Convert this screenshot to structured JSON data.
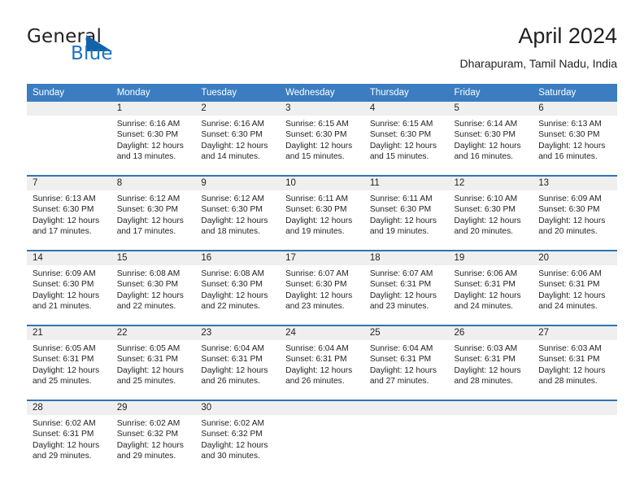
{
  "brand": {
    "word_one": "General",
    "word_two": "Blue",
    "logo_icon": "triangle-logo-icon"
  },
  "header": {
    "title": "April 2024",
    "subtitle": "Dharapuram, Tamil Nadu, India"
  },
  "colors": {
    "header_blue": "#3b7dc0",
    "row_divider_blue": "#2f73b5",
    "daynum_gray": "#efefef",
    "brand_blue": "#1e73be",
    "text": "#231f20"
  },
  "weekday_headers": [
    "Sunday",
    "Monday",
    "Tuesday",
    "Wednesday",
    "Thursday",
    "Friday",
    "Saturday"
  ],
  "weeks": [
    [
      {
        "day": "",
        "lines": []
      },
      {
        "day": "1",
        "lines": [
          "Sunrise: 6:16 AM",
          "Sunset: 6:30 PM",
          "Daylight: 12 hours",
          "and 13 minutes."
        ]
      },
      {
        "day": "2",
        "lines": [
          "Sunrise: 6:16 AM",
          "Sunset: 6:30 PM",
          "Daylight: 12 hours",
          "and 14 minutes."
        ]
      },
      {
        "day": "3",
        "lines": [
          "Sunrise: 6:15 AM",
          "Sunset: 6:30 PM",
          "Daylight: 12 hours",
          "and 15 minutes."
        ]
      },
      {
        "day": "4",
        "lines": [
          "Sunrise: 6:15 AM",
          "Sunset: 6:30 PM",
          "Daylight: 12 hours",
          "and 15 minutes."
        ]
      },
      {
        "day": "5",
        "lines": [
          "Sunrise: 6:14 AM",
          "Sunset: 6:30 PM",
          "Daylight: 12 hours",
          "and 16 minutes."
        ]
      },
      {
        "day": "6",
        "lines": [
          "Sunrise: 6:13 AM",
          "Sunset: 6:30 PM",
          "Daylight: 12 hours",
          "and 16 minutes."
        ]
      }
    ],
    [
      {
        "day": "7",
        "lines": [
          "Sunrise: 6:13 AM",
          "Sunset: 6:30 PM",
          "Daylight: 12 hours",
          "and 17 minutes."
        ]
      },
      {
        "day": "8",
        "lines": [
          "Sunrise: 6:12 AM",
          "Sunset: 6:30 PM",
          "Daylight: 12 hours",
          "and 17 minutes."
        ]
      },
      {
        "day": "9",
        "lines": [
          "Sunrise: 6:12 AM",
          "Sunset: 6:30 PM",
          "Daylight: 12 hours",
          "and 18 minutes."
        ]
      },
      {
        "day": "10",
        "lines": [
          "Sunrise: 6:11 AM",
          "Sunset: 6:30 PM",
          "Daylight: 12 hours",
          "and 19 minutes."
        ]
      },
      {
        "day": "11",
        "lines": [
          "Sunrise: 6:11 AM",
          "Sunset: 6:30 PM",
          "Daylight: 12 hours",
          "and 19 minutes."
        ]
      },
      {
        "day": "12",
        "lines": [
          "Sunrise: 6:10 AM",
          "Sunset: 6:30 PM",
          "Daylight: 12 hours",
          "and 20 minutes."
        ]
      },
      {
        "day": "13",
        "lines": [
          "Sunrise: 6:09 AM",
          "Sunset: 6:30 PM",
          "Daylight: 12 hours",
          "and 20 minutes."
        ]
      }
    ],
    [
      {
        "day": "14",
        "lines": [
          "Sunrise: 6:09 AM",
          "Sunset: 6:30 PM",
          "Daylight: 12 hours",
          "and 21 minutes."
        ]
      },
      {
        "day": "15",
        "lines": [
          "Sunrise: 6:08 AM",
          "Sunset: 6:30 PM",
          "Daylight: 12 hours",
          "and 22 minutes."
        ]
      },
      {
        "day": "16",
        "lines": [
          "Sunrise: 6:08 AM",
          "Sunset: 6:30 PM",
          "Daylight: 12 hours",
          "and 22 minutes."
        ]
      },
      {
        "day": "17",
        "lines": [
          "Sunrise: 6:07 AM",
          "Sunset: 6:30 PM",
          "Daylight: 12 hours",
          "and 23 minutes."
        ]
      },
      {
        "day": "18",
        "lines": [
          "Sunrise: 6:07 AM",
          "Sunset: 6:31 PM",
          "Daylight: 12 hours",
          "and 23 minutes."
        ]
      },
      {
        "day": "19",
        "lines": [
          "Sunrise: 6:06 AM",
          "Sunset: 6:31 PM",
          "Daylight: 12 hours",
          "and 24 minutes."
        ]
      },
      {
        "day": "20",
        "lines": [
          "Sunrise: 6:06 AM",
          "Sunset: 6:31 PM",
          "Daylight: 12 hours",
          "and 24 minutes."
        ]
      }
    ],
    [
      {
        "day": "21",
        "lines": [
          "Sunrise: 6:05 AM",
          "Sunset: 6:31 PM",
          "Daylight: 12 hours",
          "and 25 minutes."
        ]
      },
      {
        "day": "22",
        "lines": [
          "Sunrise: 6:05 AM",
          "Sunset: 6:31 PM",
          "Daylight: 12 hours",
          "and 25 minutes."
        ]
      },
      {
        "day": "23",
        "lines": [
          "Sunrise: 6:04 AM",
          "Sunset: 6:31 PM",
          "Daylight: 12 hours",
          "and 26 minutes."
        ]
      },
      {
        "day": "24",
        "lines": [
          "Sunrise: 6:04 AM",
          "Sunset: 6:31 PM",
          "Daylight: 12 hours",
          "and 26 minutes."
        ]
      },
      {
        "day": "25",
        "lines": [
          "Sunrise: 6:04 AM",
          "Sunset: 6:31 PM",
          "Daylight: 12 hours",
          "and 27 minutes."
        ]
      },
      {
        "day": "26",
        "lines": [
          "Sunrise: 6:03 AM",
          "Sunset: 6:31 PM",
          "Daylight: 12 hours",
          "and 28 minutes."
        ]
      },
      {
        "day": "27",
        "lines": [
          "Sunrise: 6:03 AM",
          "Sunset: 6:31 PM",
          "Daylight: 12 hours",
          "and 28 minutes."
        ]
      }
    ],
    [
      {
        "day": "28",
        "lines": [
          "Sunrise: 6:02 AM",
          "Sunset: 6:31 PM",
          "Daylight: 12 hours",
          "and 29 minutes."
        ]
      },
      {
        "day": "29",
        "lines": [
          "Sunrise: 6:02 AM",
          "Sunset: 6:32 PM",
          "Daylight: 12 hours",
          "and 29 minutes."
        ]
      },
      {
        "day": "30",
        "lines": [
          "Sunrise: 6:02 AM",
          "Sunset: 6:32 PM",
          "Daylight: 12 hours",
          "and 30 minutes."
        ]
      },
      {
        "day": "",
        "lines": []
      },
      {
        "day": "",
        "lines": []
      },
      {
        "day": "",
        "lines": []
      },
      {
        "day": "",
        "lines": []
      }
    ]
  ]
}
